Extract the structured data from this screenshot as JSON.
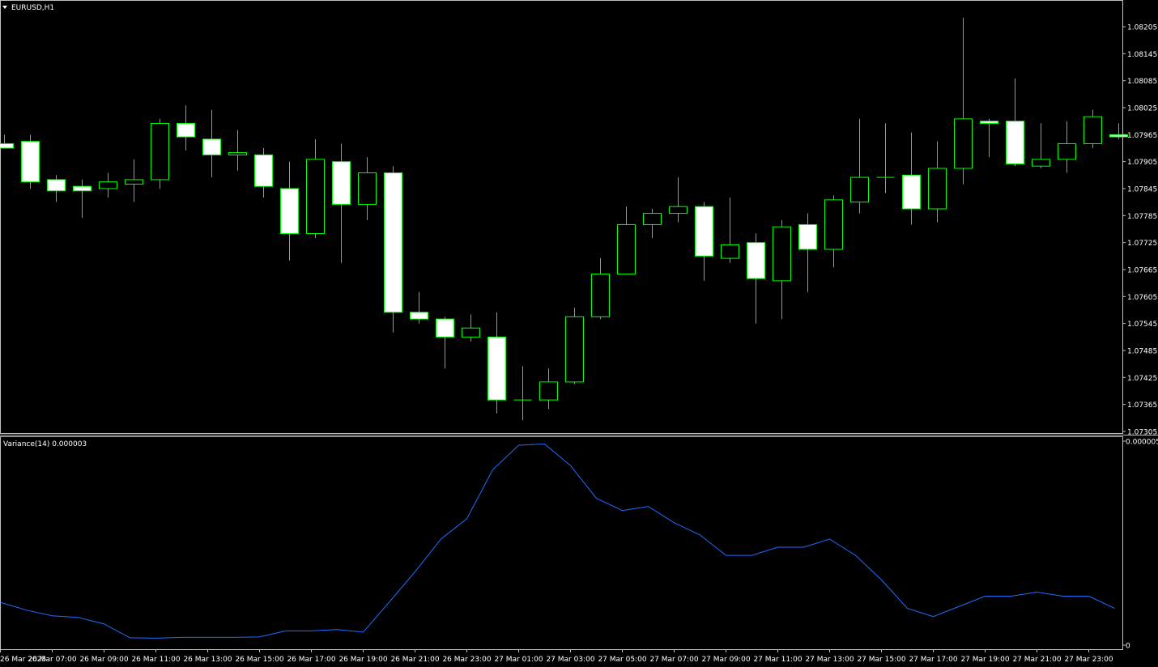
{
  "header": {
    "symbol_label": "EURUSD,H1"
  },
  "colors": {
    "background": "#000000",
    "frame": "#c0c0c0",
    "candle_outline": "#00ff00",
    "bull_fill": "#000000",
    "bear_fill": "#ffffff",
    "variance_line": "#1e6fff",
    "text": "#ffffff"
  },
  "icons": {
    "symbol_menu": "triangle-down-icon"
  },
  "chart_data": [
    {
      "type": "candlestick",
      "title": "EURUSD,H1",
      "price_ticks": [
        "1.08205",
        "1.08145",
        "1.08085",
        "1.08025",
        "1.07965",
        "1.07905",
        "1.07845",
        "1.07785",
        "1.07725",
        "1.07665",
        "1.07605",
        "1.07545",
        "1.07485",
        "1.07425",
        "1.07365",
        "1.07305"
      ],
      "ylim": [
        1.07305,
        1.08235
      ],
      "candles": [
        {
          "o": 1.07945,
          "h": 1.07965,
          "l": 1.07935,
          "c": 1.07935
        },
        {
          "o": 1.0795,
          "h": 1.07965,
          "l": 1.07845,
          "c": 1.0786
        },
        {
          "o": 1.07865,
          "h": 1.07875,
          "l": 1.07815,
          "c": 1.0784
        },
        {
          "o": 1.0785,
          "h": 1.07865,
          "l": 1.0778,
          "c": 1.0784
        },
        {
          "o": 1.07845,
          "h": 1.0788,
          "l": 1.07825,
          "c": 1.0786
        },
        {
          "o": 1.07855,
          "h": 1.0791,
          "l": 1.07815,
          "c": 1.07865
        },
        {
          "o": 1.07865,
          "h": 1.08,
          "l": 1.07845,
          "c": 1.0799
        },
        {
          "o": 1.0799,
          "h": 1.0803,
          "l": 1.0793,
          "c": 1.0796
        },
        {
          "o": 1.07955,
          "h": 1.0802,
          "l": 1.0787,
          "c": 1.0792
        },
        {
          "o": 1.0792,
          "h": 1.07975,
          "l": 1.07885,
          "c": 1.07925
        },
        {
          "o": 1.0792,
          "h": 1.07935,
          "l": 1.07825,
          "c": 1.0785
        },
        {
          "o": 1.07845,
          "h": 1.07905,
          "l": 1.07685,
          "c": 1.07745
        },
        {
          "o": 1.07745,
          "h": 1.07955,
          "l": 1.07735,
          "c": 1.0791
        },
        {
          "o": 1.07905,
          "h": 1.07945,
          "l": 1.0768,
          "c": 1.0781
        },
        {
          "o": 1.0781,
          "h": 1.07915,
          "l": 1.07775,
          "c": 1.0788
        },
        {
          "o": 1.0788,
          "h": 1.07895,
          "l": 1.07525,
          "c": 1.0757
        },
        {
          "o": 1.0757,
          "h": 1.07615,
          "l": 1.07545,
          "c": 1.07555
        },
        {
          "o": 1.07555,
          "h": 1.0756,
          "l": 1.07445,
          "c": 1.07515
        },
        {
          "o": 1.07515,
          "h": 1.07565,
          "l": 1.07505,
          "c": 1.07535
        },
        {
          "o": 1.07515,
          "h": 1.0757,
          "l": 1.07345,
          "c": 1.07375
        },
        {
          "o": 1.07375,
          "h": 1.0745,
          "l": 1.0733,
          "c": 1.07375
        },
        {
          "o": 1.07375,
          "h": 1.07445,
          "l": 1.07355,
          "c": 1.07415
        },
        {
          "o": 1.07415,
          "h": 1.0758,
          "l": 1.0741,
          "c": 1.0756
        },
        {
          "o": 1.0756,
          "h": 1.0769,
          "l": 1.07555,
          "c": 1.07655
        },
        {
          "o": 1.07655,
          "h": 1.07805,
          "l": 1.07655,
          "c": 1.07765
        },
        {
          "o": 1.07765,
          "h": 1.078,
          "l": 1.07735,
          "c": 1.0779
        },
        {
          "o": 1.0779,
          "h": 1.0787,
          "l": 1.0777,
          "c": 1.07805
        },
        {
          "o": 1.07805,
          "h": 1.07815,
          "l": 1.0764,
          "c": 1.07695
        },
        {
          "o": 1.0769,
          "h": 1.07825,
          "l": 1.0768,
          "c": 1.0772
        },
        {
          "o": 1.07725,
          "h": 1.07745,
          "l": 1.07545,
          "c": 1.07645
        },
        {
          "o": 1.0764,
          "h": 1.07775,
          "l": 1.07555,
          "c": 1.0776
        },
        {
          "o": 1.07765,
          "h": 1.0779,
          "l": 1.07615,
          "c": 1.0771
        },
        {
          "o": 1.0771,
          "h": 1.0783,
          "l": 1.0767,
          "c": 1.0782
        },
        {
          "o": 1.07815,
          "h": 1.08,
          "l": 1.0779,
          "c": 1.0787
        },
        {
          "o": 1.0787,
          "h": 1.0799,
          "l": 1.07835,
          "c": 1.0787
        },
        {
          "o": 1.07875,
          "h": 1.0797,
          "l": 1.07765,
          "c": 1.078
        },
        {
          "o": 1.078,
          "h": 1.0795,
          "l": 1.0777,
          "c": 1.0789
        },
        {
          "o": 1.0789,
          "h": 1.08225,
          "l": 1.07855,
          "c": 1.08
        },
        {
          "o": 1.07995,
          "h": 1.08,
          "l": 1.07915,
          "c": 1.0799
        },
        {
          "o": 1.07995,
          "h": 1.0809,
          "l": 1.07895,
          "c": 1.079
        },
        {
          "o": 1.07895,
          "h": 1.0799,
          "l": 1.0789,
          "c": 1.0791
        },
        {
          "o": 1.0791,
          "h": 1.07995,
          "l": 1.0788,
          "c": 1.07945
        },
        {
          "o": 1.07945,
          "h": 1.0802,
          "l": 1.07935,
          "c": 1.08005
        },
        {
          "o": 1.07965,
          "h": 1.0799,
          "l": 1.07955,
          "c": 1.0796
        }
      ]
    },
    {
      "type": "line",
      "title": "Variance(14) 0.000003",
      "name": "Variance(14)",
      "y_ticks": [
        "0.000005",
        "0"
      ],
      "ylim": [
        0,
        5e-06
      ],
      "values": [
        1.05e-06,
        8.6e-07,
        7.2e-07,
        6.8e-07,
        5.2e-07,
        1.8e-07,
        1.7e-07,
        1.9e-07,
        1.9e-07,
        1.9e-07,
        2e-07,
        3.5e-07,
        3.5e-07,
        3.8e-07,
        3.2e-07,
        1.05e-06,
        1.8e-06,
        2.6e-06,
        3.1e-06,
        4.3e-06,
        4.9e-06,
        4.93e-06,
        4.4e-06,
        3.6e-06,
        3.3e-06,
        3.4e-06,
        3e-06,
        2.7e-06,
        2.2e-06,
        2.2e-06,
        2.4e-06,
        2.4e-06,
        2.6e-06,
        2.2e-06,
        1.6e-06,
        9e-07,
        7e-07,
        9.5e-07,
        1.2e-06,
        1.2e-06,
        1.3e-06,
        1.2e-06,
        1.2e-06,
        9e-07
      ]
    }
  ],
  "time_ticks": [
    "26 Mar 2025",
    "26 Mar 07:00",
    "26 Mar 09:00",
    "26 Mar 11:00",
    "26 Mar 13:00",
    "26 Mar 15:00",
    "26 Mar 17:00",
    "26 Mar 19:00",
    "26 Mar 21:00",
    "26 Mar 23:00",
    "27 Mar 01:00",
    "27 Mar 03:00",
    "27 Mar 05:00",
    "27 Mar 07:00",
    "27 Mar 09:00",
    "27 Mar 11:00",
    "27 Mar 13:00",
    "27 Mar 15:00",
    "27 Mar 17:00",
    "27 Mar 19:00",
    "27 Mar 21:00",
    "27 Mar 23:00"
  ]
}
